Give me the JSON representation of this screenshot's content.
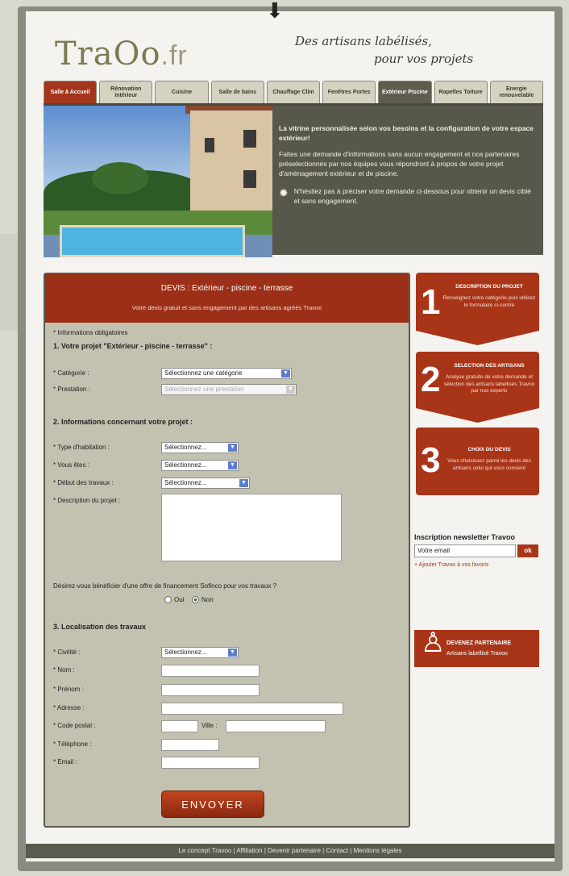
{
  "header": {
    "logo_text": "Tra",
    "logo_mid": "Oo",
    "logo_ext": ".fr",
    "slogan_line1": "Des artisans labélisés,",
    "slogan_line2": "pour vos projets"
  },
  "nav": {
    "tabs": [
      "Salle à Accueil",
      "Rénovation intérieur",
      "Cuisine",
      "Salle de bains",
      "Chauffage Clim",
      "Fenêtres Portes",
      "Extérieur Piscine",
      "Rapelles Toiture",
      "Energie renouvelable"
    ]
  },
  "hero": {
    "title": "La vitrine personnalisée selon vos besoins et la configuration de votre espace extérieur!",
    "body": "Faites une demande d'informations sans aucun engagement et nos partenaires préselectionnés par nos équipes vous répondront à propos de votre projet d'aménagement extérieur et de piscine.",
    "note": "N'hésitez pas à préciser votre demande ci-dessous pour obtenir un devis ciblé et sans engagement."
  },
  "form": {
    "title": "DEVIS : Extérieur - piscine - terrasse",
    "subtitle": "Votre devis gratuit et sans engagement par des artisans agréés Travoo",
    "required_note": "* Informations obligatoires",
    "section1": "1. Votre projet \"Extérieur - piscine - terrasse\" :",
    "categorie_label": "* Catégorie :",
    "categorie_value": "Sélectionnez une catégorie",
    "prestation_label": "* Prestation :",
    "prestation_value": "Sélectionnez une prestation",
    "section2": "2. Informations concernant votre projet :",
    "habitation_label": "* Type d'habitation :",
    "habitation_value": "Sélectionnez...",
    "etes_label": "* Vous êtes :",
    "etes_value": "Sélectionnez...",
    "debut_label": "* Début des travaux :",
    "debut_value": "Sélectionnez...",
    "desc_label": "* Description du projet :",
    "financement_q": "Désirez-vous bénéficier d'une offre de financement Sofinco pour vos travaux ?",
    "oui": "Oui",
    "non": "Non",
    "section3": "3. Localisation des travaux",
    "civilite_label": "* Civilité :",
    "civilite_value": "Sélectionnez...",
    "nom_label": "* Nom :",
    "prenom_label": "* Prénom :",
    "adresse_label": "* Adresse :",
    "cp_label": "* Code postal :",
    "ville_label": "Ville :",
    "tel_label": "* Téléphone :",
    "email_label": "* Email :",
    "submit": "ENVOYER"
  },
  "steps": [
    {
      "num": "1",
      "title": "DESCRIPTION DU PROJET",
      "desc": "Renseignez votre catégorie puis utilisez le formulaire ci-contre"
    },
    {
      "num": "2",
      "title": "SELECTION DES ARTISANS",
      "desc": "Analyse gratuite de votre demande et sélection des artisans labellisés Travoo par nos experts"
    },
    {
      "num": "3",
      "title": "CHOIX DU DEVIS",
      "desc": "Vous choisissez parmi les devis des artisans celui qui vous convient"
    }
  ],
  "newsletter": {
    "title": "Inscription newsletter Travoo",
    "placeholder": "Votre email",
    "button": "ok",
    "link": "+ Ajouter Travoo à vos favoris"
  },
  "partner": {
    "title": "DEVENEZ PARTENAIRE",
    "subtitle": "Artisans labellisé Travoo"
  },
  "footer": {
    "text": "Le concept Travoo  |  Affiliation  |  Devenir partenaire  |  Contact  |  Mentions légales"
  }
}
